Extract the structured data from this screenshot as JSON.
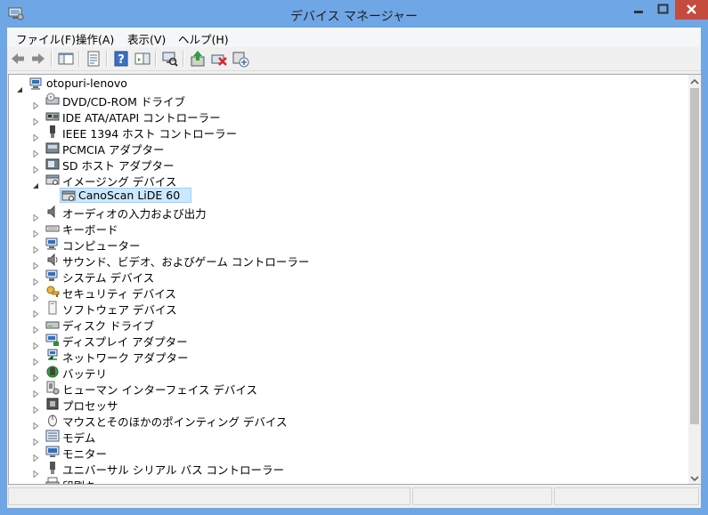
{
  "window": {
    "title": "デバイス マネージャー",
    "app_icon": "device-manager-icon"
  },
  "menu": [
    {
      "label": "ファイル(F)"
    },
    {
      "label": "操作(A)"
    },
    {
      "label": "表示(V)"
    },
    {
      "label": "ヘルプ(H)"
    }
  ],
  "toolbar": [
    "back-icon",
    "forward-icon",
    "show-hide-console-tree-icon",
    "properties-icon",
    "help-icon",
    "action-pane-icon",
    "scan-hardware-icon",
    "update-driver-icon",
    "uninstall-device-icon",
    "add-legacy-hardware-icon"
  ],
  "tree": {
    "root": {
      "label": "otopuri-lenovo",
      "icon": "computer-icon",
      "expanded": true
    },
    "items": [
      {
        "label": "DVD/CD-ROM ドライブ",
        "icon": "dvd-drive-icon",
        "expanded": false
      },
      {
        "label": "IDE ATA/ATAPI コントローラー",
        "icon": "ide-controller-icon",
        "expanded": false
      },
      {
        "label": "IEEE 1394 ホスト コントローラー",
        "icon": "firewire-icon",
        "expanded": false
      },
      {
        "label": "PCMCIA アダプター",
        "icon": "pcmcia-icon",
        "expanded": false
      },
      {
        "label": "SD ホスト アダプター",
        "icon": "sd-host-icon",
        "expanded": false
      },
      {
        "label": "イメージング デバイス",
        "icon": "imaging-device-icon",
        "expanded": true,
        "children": [
          {
            "label": "CanoScan LiDE 60",
            "icon": "scanner-icon",
            "selected": true
          }
        ]
      },
      {
        "label": "オーディオの入力および出力",
        "icon": "audio-io-icon",
        "expanded": false
      },
      {
        "label": "キーボード",
        "icon": "keyboard-icon",
        "expanded": false
      },
      {
        "label": "コンピューター",
        "icon": "computer-icon",
        "expanded": false
      },
      {
        "label": "サウンド、ビデオ、およびゲーム コントローラー",
        "icon": "sound-icon",
        "expanded": false
      },
      {
        "label": "システム デバイス",
        "icon": "system-device-icon",
        "expanded": false
      },
      {
        "label": "セキュリティ デバイス",
        "icon": "security-device-icon",
        "expanded": false
      },
      {
        "label": "ソフトウェア デバイス",
        "icon": "software-device-icon",
        "expanded": false
      },
      {
        "label": "ディスク ドライブ",
        "icon": "disk-drive-icon",
        "expanded": false
      },
      {
        "label": "ディスプレイ アダプター",
        "icon": "display-adapter-icon",
        "expanded": false
      },
      {
        "label": "ネットワーク アダプター",
        "icon": "network-adapter-icon",
        "expanded": false
      },
      {
        "label": "バッテリ",
        "icon": "battery-icon",
        "expanded": false
      },
      {
        "label": "ヒューマン インターフェイス デバイス",
        "icon": "hid-icon",
        "expanded": false
      },
      {
        "label": "プロセッサ",
        "icon": "processor-icon",
        "expanded": false
      },
      {
        "label": "マウスとそのほかのポインティング デバイス",
        "icon": "mouse-icon",
        "expanded": false
      },
      {
        "label": "モデム",
        "icon": "modem-icon",
        "expanded": false
      },
      {
        "label": "モニター",
        "icon": "monitor-icon",
        "expanded": false
      },
      {
        "label": "ユニバーサル シリアル バス コントローラー",
        "icon": "usb-controller-icon",
        "expanded": false
      },
      {
        "label": "印刷キュー",
        "icon": "print-queue-icon",
        "expanded": false
      }
    ]
  },
  "colors": {
    "frame": "#6fa6e6",
    "close": "#c74a3e",
    "selection": "#cce8ff",
    "selection_border": "#99d1ff"
  }
}
